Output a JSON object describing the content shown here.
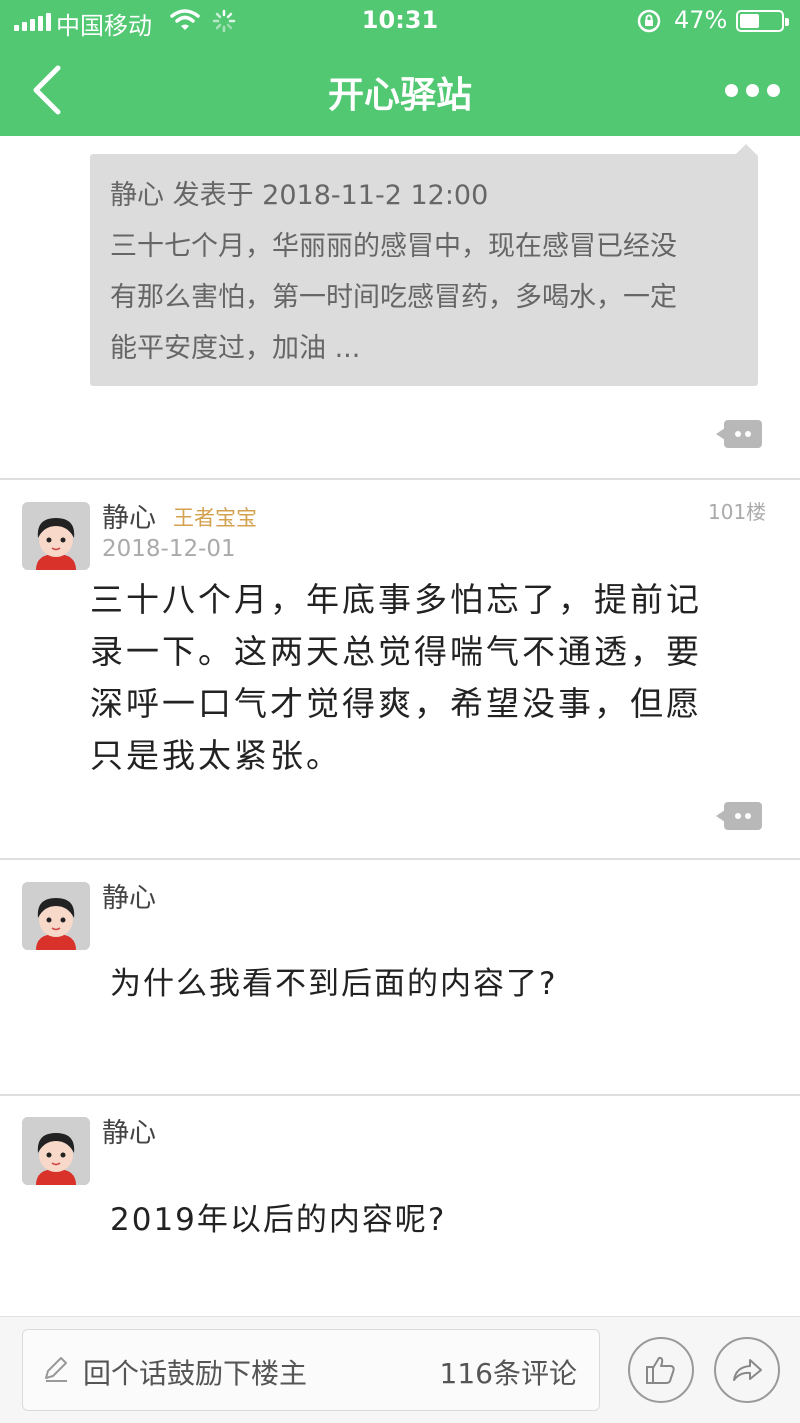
{
  "status_bar": {
    "carrier": "中国移动",
    "time": "10:31",
    "battery_percent": "47%",
    "battery_level": 0.47
  },
  "nav": {
    "title": "开心驿站"
  },
  "quoted_post": {
    "header": "静心 发表于 2018-11-2 12:00",
    "lines": [
      "三十七个月，华丽丽的感冒中，现在感冒已经没",
      "有那么害怕，第一时间吃感冒药，多喝水，一定",
      "能平安度过，加油 ..."
    ]
  },
  "post": {
    "username": "静心",
    "badge": "王者宝宝",
    "date": "2018-12-01",
    "floor": "101楼",
    "lines": [
      "三十八个月，年底事多怕忘了，提前记",
      "录一下。这两天总觉得喘气不通透，要",
      "深呼一口气才觉得爽，希望没事，但愿",
      "只是我太紧张。"
    ]
  },
  "replies": [
    {
      "username": "静心",
      "text": "为什么我看不到后面的内容了?"
    },
    {
      "username": "静心",
      "text": "2019年以后的内容呢?"
    }
  ],
  "bottom_bar": {
    "placeholder": "回个话鼓励下楼主",
    "comment_count": "116条评论"
  },
  "colors": {
    "brand_green": "#52c873",
    "badge_gold": "#d4a14f"
  }
}
